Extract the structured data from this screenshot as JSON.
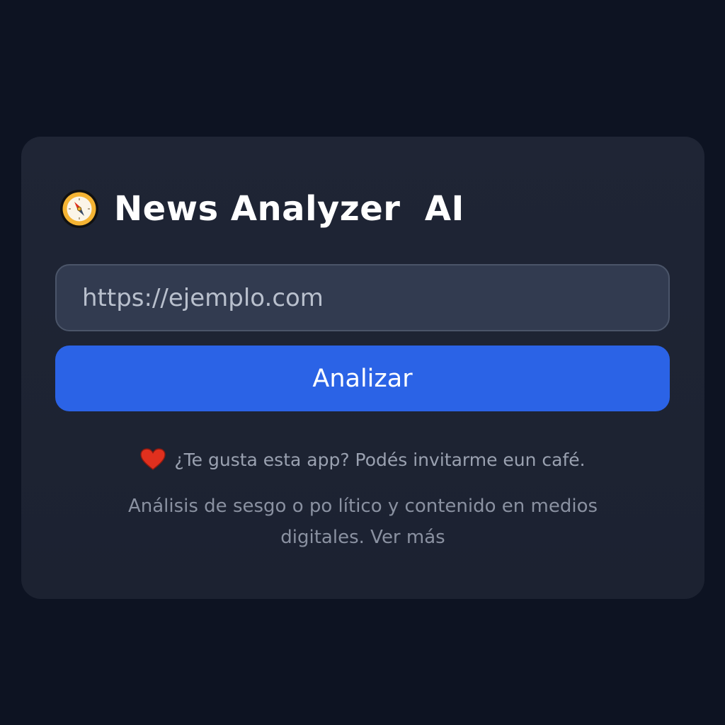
{
  "header": {
    "logo_icon": "compass-icon",
    "title": "News Analyzer  AI"
  },
  "form": {
    "url_placeholder": "https://ejemplo.com",
    "url_value": "",
    "analyze_label": "Analizar"
  },
  "footer": {
    "heart_icon": "heart-icon",
    "coffee_text": "¿Te gusta esta app? Podés invitarme eun café.",
    "description": "Análisis de sesgo o po lítico y contenido en medios digitales.",
    "more_link": "Ver más"
  },
  "colors": {
    "background": "#0d1322",
    "card": "#1f2535",
    "input": "#323b50",
    "accent": "#2b63e6",
    "heart": "#e0301e",
    "compass": "#f5b433"
  }
}
